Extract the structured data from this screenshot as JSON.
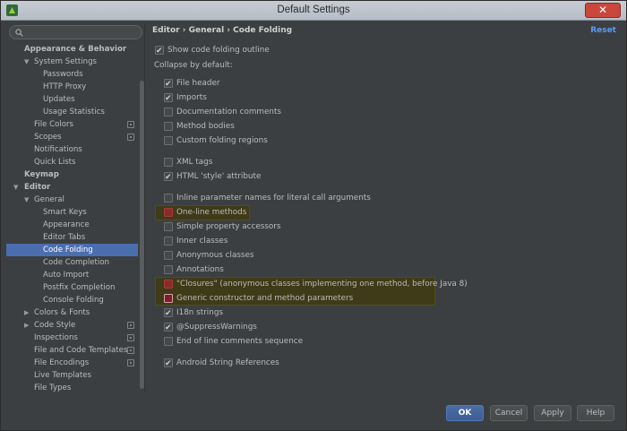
{
  "window": {
    "title": "Default Settings",
    "close_label": "✕"
  },
  "search": {
    "placeholder": ""
  },
  "sidebar": {
    "items": [
      {
        "label": "Appearance & Behavior",
        "level": 0,
        "bold": true,
        "arrow": ""
      },
      {
        "label": "System Settings",
        "level": 1,
        "arrow": "▼"
      },
      {
        "label": "Passwords",
        "level": 2
      },
      {
        "label": "HTTP Proxy",
        "level": 2
      },
      {
        "label": "Updates",
        "level": 2
      },
      {
        "label": "Usage Statistics",
        "level": 2
      },
      {
        "label": "File Colors",
        "level": 1,
        "project_icon": true
      },
      {
        "label": "Scopes",
        "level": 1,
        "project_icon": true
      },
      {
        "label": "Notifications",
        "level": 1
      },
      {
        "label": "Quick Lists",
        "level": 1
      },
      {
        "label": "Keymap",
        "level": 0,
        "bold": true
      },
      {
        "label": "Editor",
        "level": 0,
        "bold": true,
        "arrow": "▼"
      },
      {
        "label": "General",
        "level": 1,
        "arrow": "▼"
      },
      {
        "label": "Smart Keys",
        "level": 2
      },
      {
        "label": "Appearance",
        "level": 2
      },
      {
        "label": "Editor Tabs",
        "level": 2
      },
      {
        "label": "Code Folding",
        "level": 2,
        "selected": true
      },
      {
        "label": "Code Completion",
        "level": 2
      },
      {
        "label": "Auto Import",
        "level": 2
      },
      {
        "label": "Postfix Completion",
        "level": 2
      },
      {
        "label": "Console Folding",
        "level": 2
      },
      {
        "label": "Colors & Fonts",
        "level": 1,
        "arrow": "▶"
      },
      {
        "label": "Code Style",
        "level": 1,
        "arrow": "▶",
        "project_icon": true
      },
      {
        "label": "Inspections",
        "level": 1,
        "project_icon": true
      },
      {
        "label": "File and Code Templates",
        "level": 1,
        "project_icon": true
      },
      {
        "label": "File Encodings",
        "level": 1,
        "project_icon": true
      },
      {
        "label": "Live Templates",
        "level": 1
      },
      {
        "label": "File Types",
        "level": 1
      }
    ]
  },
  "main": {
    "breadcrumb": "Editor › General › Code Folding",
    "reset_label": "Reset",
    "show_outline": {
      "label": "Show code folding outline",
      "checked": true
    },
    "collapse_heading": "Collapse by default:",
    "options": [
      {
        "label": "File header",
        "checked": true
      },
      {
        "label": "Imports",
        "checked": true
      },
      {
        "label": "Documentation comments",
        "checked": false
      },
      {
        "label": "Method bodies",
        "checked": false
      },
      {
        "label": "Custom folding regions",
        "checked": false
      },
      {
        "label": "XML tags",
        "checked": false
      },
      {
        "label": "HTML 'style' attribute",
        "checked": true
      },
      {
        "label": "Inline parameter names for literal call arguments",
        "checked": false
      },
      {
        "label": "One-line methods",
        "checked": false,
        "highlight": true
      },
      {
        "label": "Simple property accessors",
        "checked": false
      },
      {
        "label": "Inner classes",
        "checked": false
      },
      {
        "label": "Anonymous classes",
        "checked": false
      },
      {
        "label": "Annotations",
        "checked": false
      },
      {
        "label": "\"Closures\" (anonymous classes implementing one method, before Java 8)",
        "checked": false,
        "highlight": true
      },
      {
        "label": "Generic constructor and method parameters",
        "checked": false,
        "highlight": true,
        "focused": true
      },
      {
        "label": "I18n strings",
        "checked": true
      },
      {
        "label": "@SuppressWarnings",
        "checked": true
      },
      {
        "label": "End of line comments sequence",
        "checked": false
      },
      {
        "label": "Android String References",
        "checked": true
      }
    ]
  },
  "buttons": {
    "ok": "OK",
    "cancel": "Cancel",
    "apply": "Apply",
    "help": "Help"
  },
  "colors": {
    "background": "#3c3f41",
    "selection": "#4b6eaf",
    "link": "#589df6",
    "highlight": "#3f3a18"
  }
}
